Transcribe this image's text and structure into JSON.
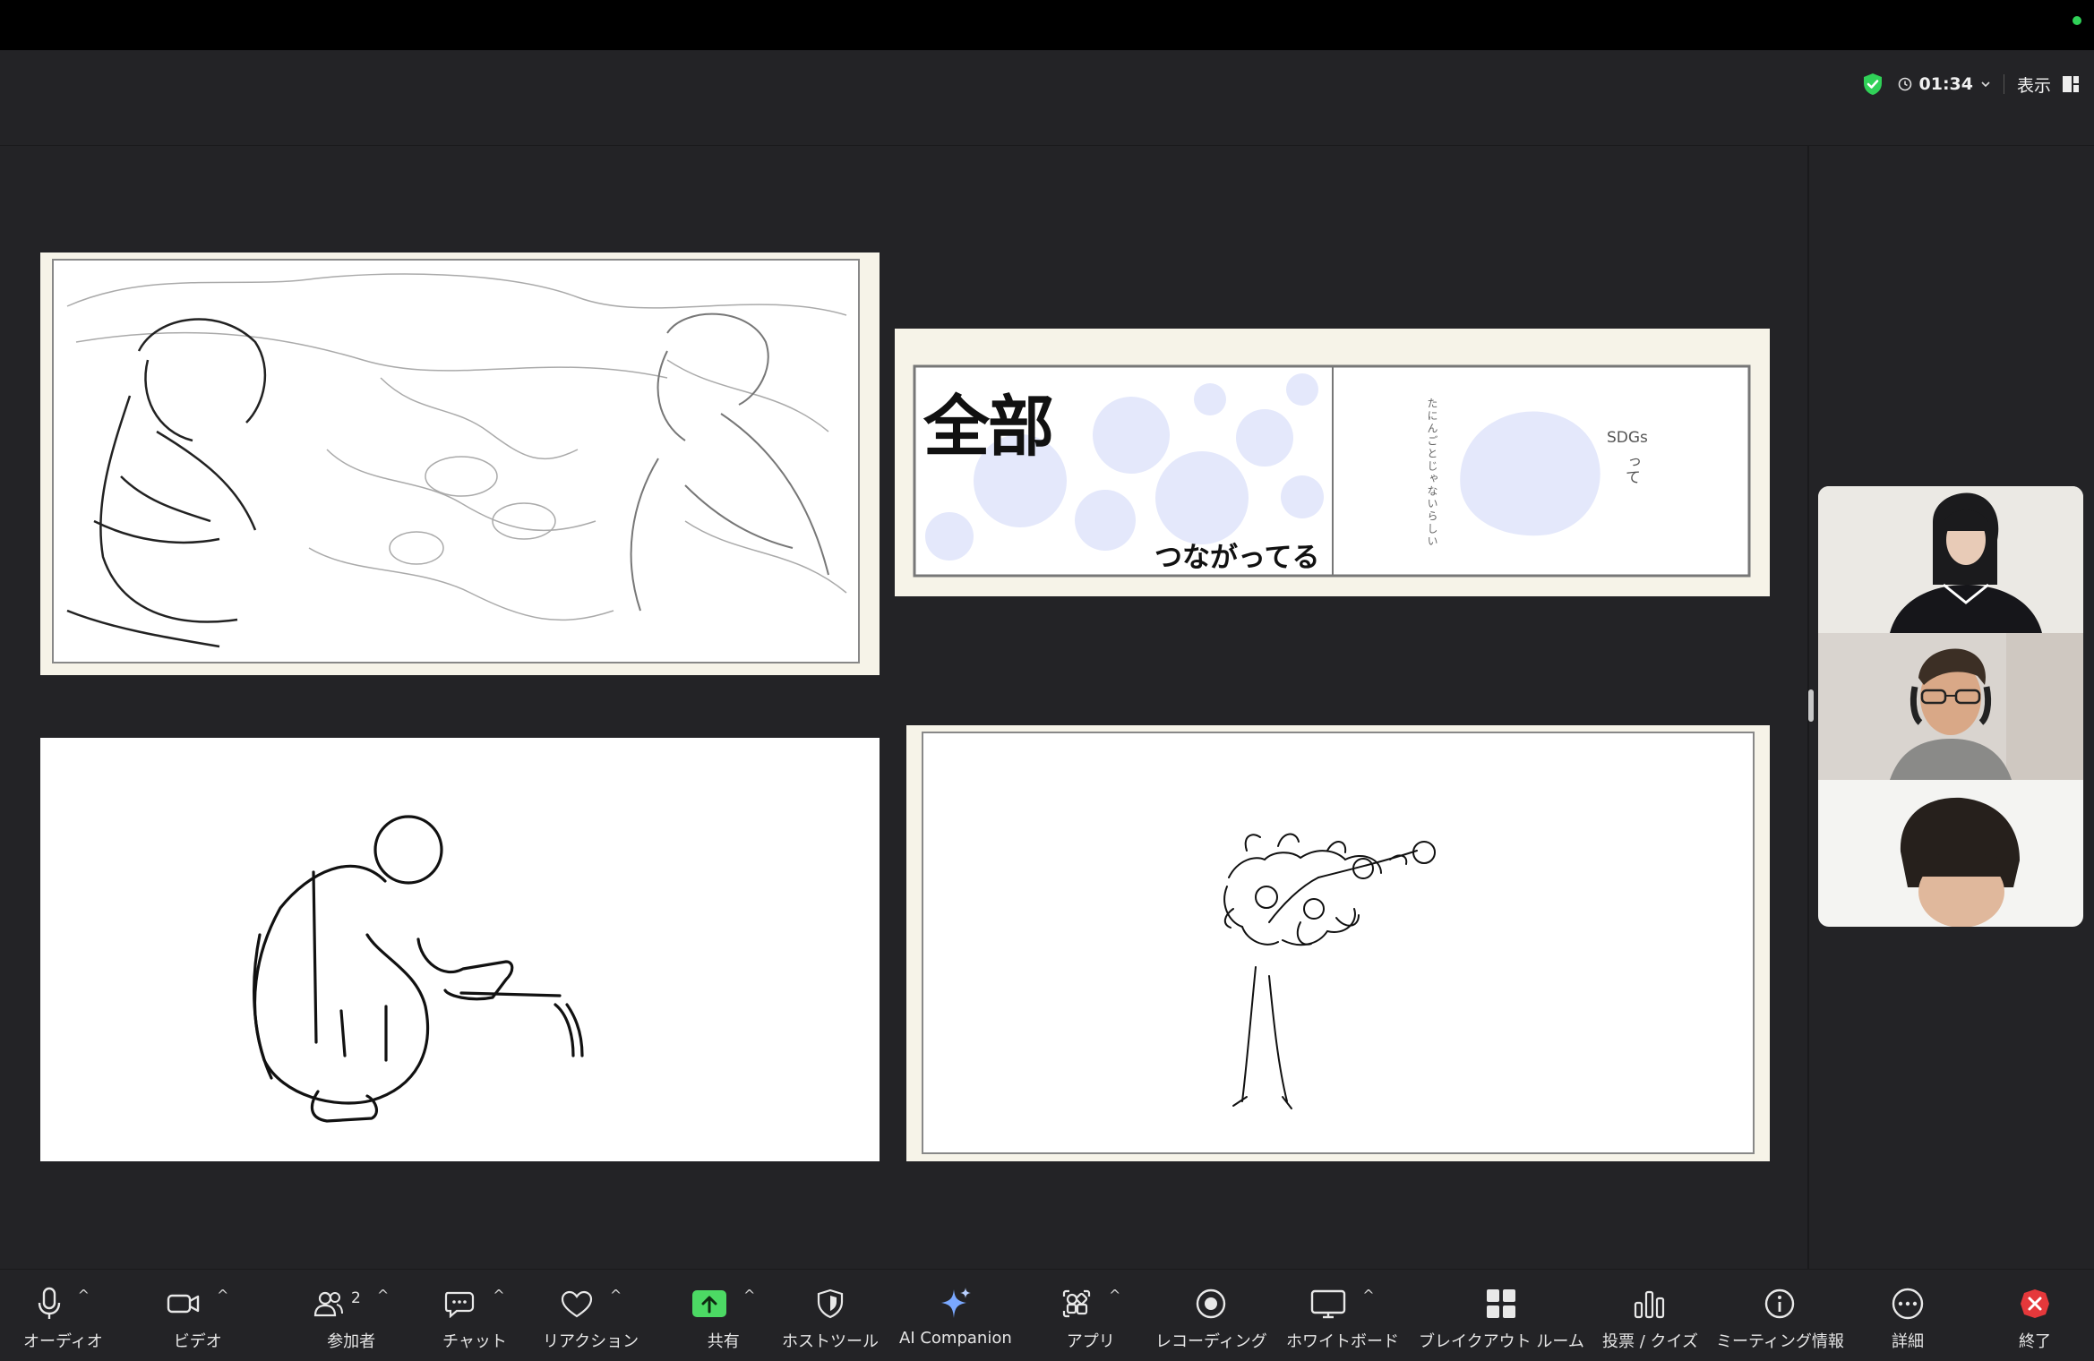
{
  "header": {
    "timer": "01:34",
    "view_label": "表示"
  },
  "slides": {
    "top_right": {
      "headline": "全部",
      "tagline": "つながってる",
      "vertical_text": "たにんごとじゃないらしい",
      "sdgs": "SDGs",
      "sdgs_tail": "って"
    }
  },
  "participants": [
    "participant-1",
    "participant-2",
    "participant-3"
  ],
  "toolbar": {
    "audio": "オーディオ",
    "video": "ビデオ",
    "participants": "参加者",
    "participants_count": "2",
    "chat": "チャット",
    "reactions": "リアクション",
    "share": "共有",
    "host_tools": "ホストツール",
    "ai_companion": "AI Companion",
    "apps": "アプリ",
    "recording": "レコーディング",
    "whiteboard": "ホワイトボード",
    "breakout": "ブレイクアウト ルーム",
    "polls": "投票 / クイズ",
    "meeting_info": "ミーティング情報",
    "more": "詳細",
    "end": "終了"
  },
  "colors": {
    "accent_green": "#30d158",
    "share_green": "#4cd964",
    "end_red": "#e5383b",
    "ai_blue": "#7aa8ff"
  }
}
